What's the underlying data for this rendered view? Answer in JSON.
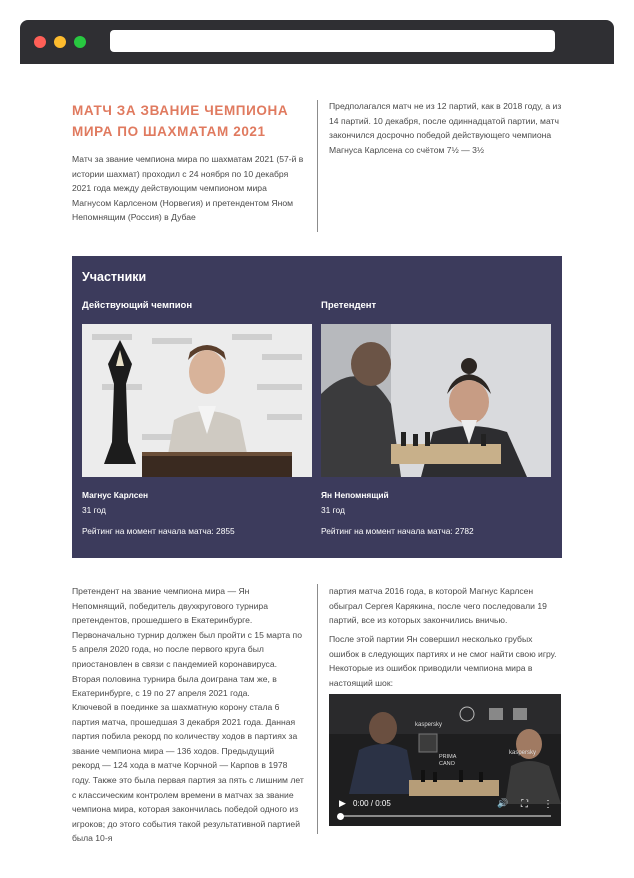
{
  "browser": {
    "address_value": ""
  },
  "intro": {
    "title": "МАТЧ ЗА ЗВАНИЕ ЧЕМПИОНА МИРА ПО ШАХМАТАМ 2021",
    "text": "Матч за звание чемпиона мира по шахматам 2021 (57-й в истории шахмат) проходил с 24 ноября по 10 декабря 2021 года между действующим чемпионом мира Магнусом Карлсеном (Норвегия) и претендентом Яном Непомнящим (Россия) в Дубае",
    "right_text": "Предполагался матч не из 12 партий, как в 2018 году, а из 14 партий. 10 декабря, после одиннадцатой партии, матч закончился досрочно победой действующего чемпиона Магнуса Карлсена со счётом 7½ — 3½"
  },
  "participants": {
    "heading": "Участники",
    "champion": {
      "role": "Действующий чемпион",
      "name": "Магнус Карлсен",
      "age": "31 год",
      "rating": "Рейтинг на момент начала матча: 2855"
    },
    "challenger": {
      "role": "Претендент",
      "name": "Ян Непомнящий",
      "age": "31 год",
      "rating": "Рейтинг на момент начала матча: 2782"
    }
  },
  "body": {
    "left_p1": "Претендент на звание чемпиона мира — Ян Непомнящий, победитель двухкругового турнира претендентов, прошедшего в Екатеринбурге. Первоначально турнир должен был пройти с 15 марта по 5 апреля 2020 года, но после первого круга был приостановлен в связи с пандемией коронавируса. Вторая половина турнира была доиграна там же, в Екатеринбурге, с 19 по 27 апреля 2021 года.",
    "left_p2": "Ключевой в поединке за шахматную корону стала 6 партия матча, прошедшая 3 декабря 2021 года. Данная партия побила рекорд по количеству ходов в партиях за звание чемпиона мира — 136 ходов. Предыдущий рекорд — 124 хода в матче Корчной — Карпов в 1978 году. Также это была первая партия за пять с лишним лет с классическим контролем времени в матчах за звание чемпиона мира, которая закончилась победой одного из игроков; до этого события такой результативной партией была 10-я",
    "right_p1": "партия матча 2016 года, в которой Магнус Карлсен обыграл Сергея Карякина, после чего последовали 19 партий, все из которых закончились вничью.",
    "right_p2": "После этой партии Ян совершил несколько грубых ошибок в следующих партиях и не смог найти свою игру. Некоторые из ошибок приводили чемпиона мира в настоящий шок:"
  },
  "video": {
    "time": "0:00 / 0:05",
    "progress": 0,
    "sponsor_labels": [
      "kaspersky",
      "kaspersky",
      "PRIMA CANO"
    ]
  },
  "colors": {
    "accent": "#e07a5f",
    "panel": "#3c3b5c",
    "window_bar": "#2f2f33"
  }
}
